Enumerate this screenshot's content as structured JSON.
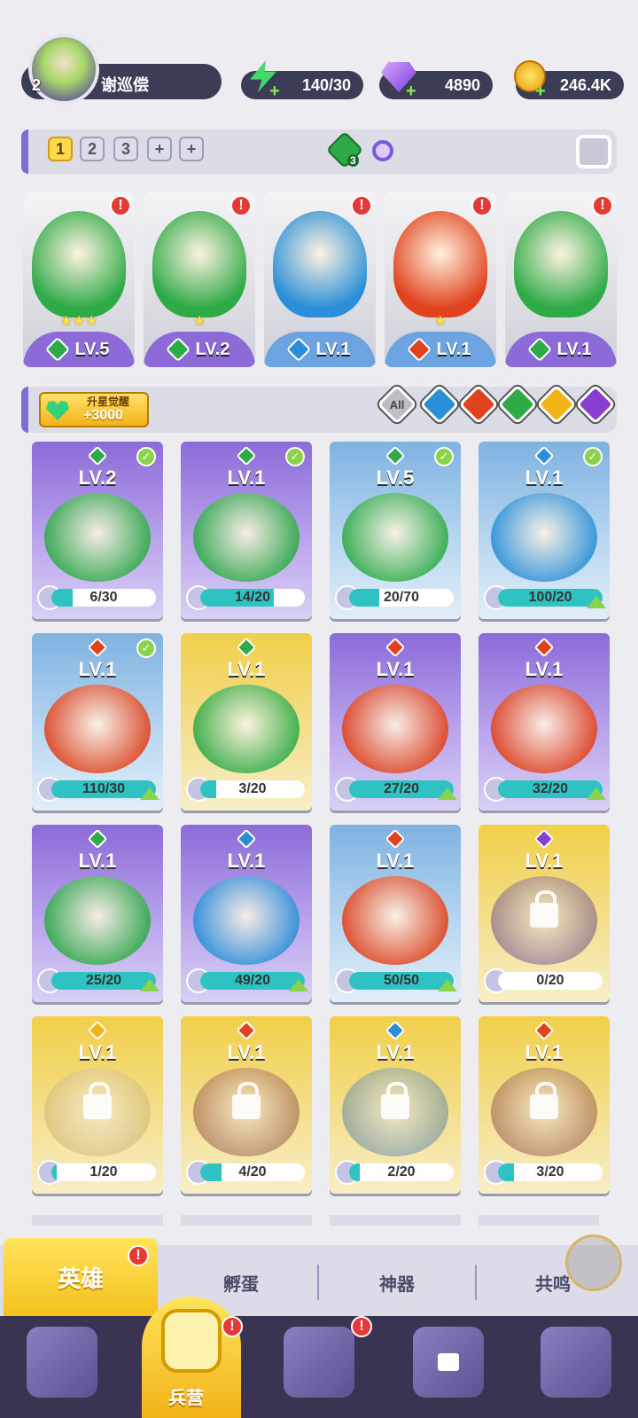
{
  "header": {
    "player_level": "2",
    "player_name": "谢巡偿",
    "energy": "140/30",
    "gems": "4890",
    "coins": "246.4K"
  },
  "team_bar": {
    "slots": [
      "1",
      "2",
      "3",
      "+",
      "+"
    ],
    "active_slot": "1",
    "formation_count": "3"
  },
  "team": [
    {
      "level": "LV.5",
      "element": "wind",
      "stars": 3
    },
    {
      "level": "LV.2",
      "element": "wind",
      "stars": 1
    },
    {
      "level": "LV.1",
      "element": "water",
      "stars": 0
    },
    {
      "level": "LV.1",
      "element": "fire",
      "stars": 1
    },
    {
      "level": "LV.1",
      "element": "wind",
      "stars": 0
    }
  ],
  "awaken": {
    "title": "升星觉醒",
    "value": "+3000"
  },
  "filters": {
    "all_label": "All",
    "elements": [
      "water",
      "fire",
      "wind",
      "light",
      "dark"
    ]
  },
  "heroes": [
    {
      "level": "LV.2",
      "element": "wind",
      "progress": "6/30",
      "fraction": 0.2,
      "owned": true,
      "upgrade": false,
      "checked": true,
      "rarity": "purple"
    },
    {
      "level": "LV.1",
      "element": "wind",
      "progress": "14/20",
      "fraction": 0.7,
      "owned": true,
      "upgrade": false,
      "checked": true,
      "rarity": "purple"
    },
    {
      "level": "LV.5",
      "element": "wind",
      "progress": "20/70",
      "fraction": 0.29,
      "owned": true,
      "upgrade": false,
      "checked": true,
      "rarity": "blue"
    },
    {
      "level": "LV.1",
      "element": "water",
      "progress": "100/20",
      "fraction": 1.0,
      "owned": true,
      "upgrade": true,
      "checked": true,
      "rarity": "blue"
    },
    {
      "level": "LV.1",
      "element": "fire",
      "progress": "110/30",
      "fraction": 1.0,
      "owned": true,
      "upgrade": true,
      "checked": true,
      "rarity": "blue"
    },
    {
      "level": "LV.1",
      "element": "wind",
      "progress": "3/20",
      "fraction": 0.15,
      "owned": true,
      "upgrade": false,
      "checked": false,
      "rarity": "gold"
    },
    {
      "level": "LV.1",
      "element": "fire",
      "progress": "27/20",
      "fraction": 1.0,
      "owned": true,
      "upgrade": true,
      "checked": false,
      "rarity": "purple"
    },
    {
      "level": "LV.1",
      "element": "fire",
      "progress": "32/20",
      "fraction": 1.0,
      "owned": true,
      "upgrade": true,
      "checked": false,
      "rarity": "purple"
    },
    {
      "level": "LV.1",
      "element": "wind",
      "progress": "25/20",
      "fraction": 1.0,
      "owned": true,
      "upgrade": true,
      "checked": false,
      "rarity": "purple"
    },
    {
      "level": "LV.1",
      "element": "water",
      "progress": "49/20",
      "fraction": 1.0,
      "owned": true,
      "upgrade": true,
      "checked": false,
      "rarity": "purple"
    },
    {
      "level": "LV.1",
      "element": "fire",
      "progress": "50/50",
      "fraction": 1.0,
      "owned": true,
      "upgrade": true,
      "checked": false,
      "rarity": "blue"
    },
    {
      "level": "LV.1",
      "element": "dark",
      "progress": "0/20",
      "fraction": 0.0,
      "owned": false,
      "upgrade": false,
      "checked": false,
      "rarity": "gold"
    },
    {
      "level": "LV.1",
      "element": "light",
      "progress": "1/20",
      "fraction": 0.05,
      "owned": false,
      "upgrade": false,
      "checked": false,
      "rarity": "gold"
    },
    {
      "level": "LV.1",
      "element": "fire",
      "progress": "4/20",
      "fraction": 0.2,
      "owned": false,
      "upgrade": false,
      "checked": false,
      "rarity": "gold"
    },
    {
      "level": "LV.1",
      "element": "water",
      "progress": "2/20",
      "fraction": 0.1,
      "owned": false,
      "upgrade": false,
      "checked": false,
      "rarity": "gold"
    },
    {
      "level": "LV.1",
      "element": "fire",
      "progress": "3/20",
      "fraction": 0.15,
      "owned": false,
      "upgrade": false,
      "checked": false,
      "rarity": "gold"
    }
  ],
  "subtabs": [
    "英雄",
    "孵蛋",
    "神器",
    "共鸣"
  ],
  "bottom_nav": {
    "active_label": "兵营",
    "items": [
      "cards",
      "barracks",
      "map",
      "shop-locked",
      "guild"
    ]
  },
  "colors": {
    "wind": "#2eaa47",
    "water": "#2a8fd8",
    "fire": "#e0421d",
    "light": "#f2b318",
    "dark": "#8a3dd1",
    "purple": "#8c6bd8",
    "blue": "#7fb2e0",
    "gold": "#e8c23a",
    "accent": "#ffd94a"
  }
}
